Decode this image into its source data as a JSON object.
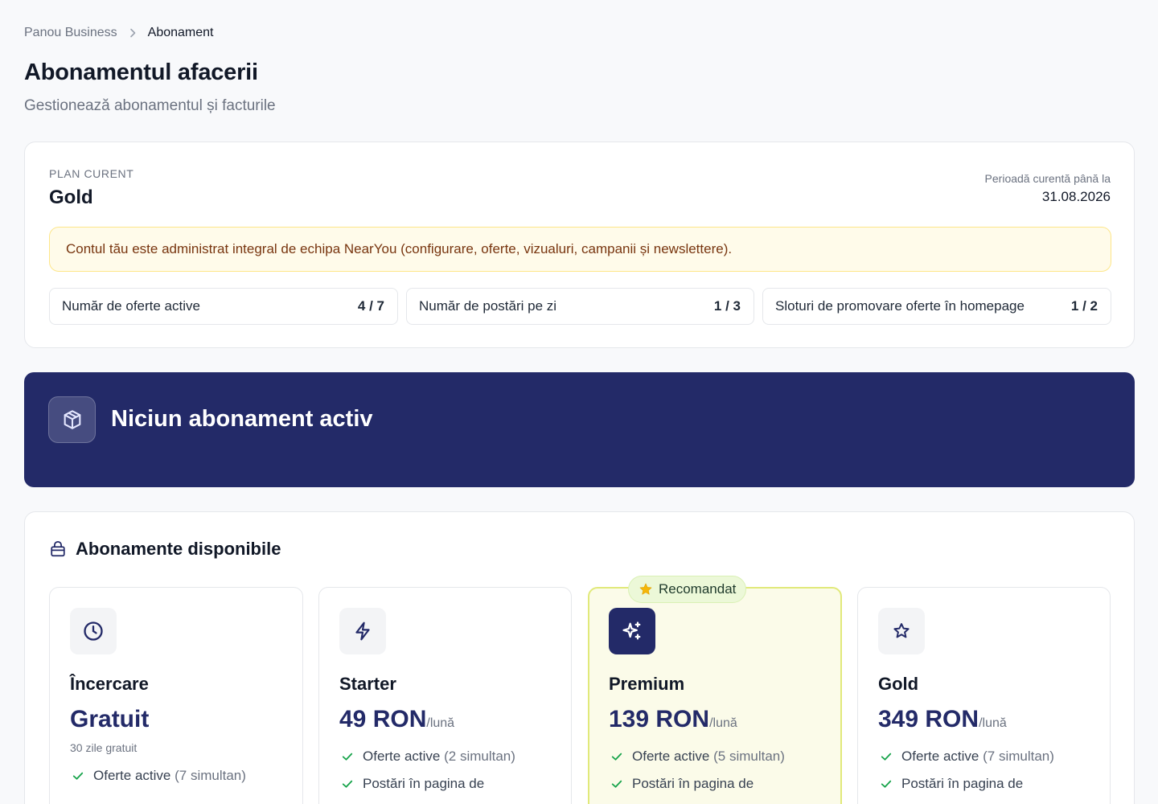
{
  "breadcrumb": {
    "parent": "Panou Business",
    "current": "Abonament"
  },
  "header": {
    "title": "Abonamentul afacerii",
    "subtitle": "Gestionează abonamentul și facturile"
  },
  "current_plan": {
    "label": "PLAN CURENT",
    "name": "Gold",
    "period_label": "Perioadă curentă până la",
    "period_end": "31.08.2026",
    "notice": "Contul tău este administrat integral de echipa NearYou (configurare, oferte, vizualuri, campanii și newslettere).",
    "metrics": [
      {
        "label": "Număr de oferte active",
        "value": "4 / 7"
      },
      {
        "label": "Număr de postări pe zi",
        "value": "1 / 3"
      },
      {
        "label": "Sloturi de promovare oferte în homepage",
        "value": "1 / 2"
      }
    ]
  },
  "banner": {
    "icon": "cube-icon",
    "title": "Niciun abonament activ"
  },
  "available": {
    "title": "Abonamente disponibile",
    "icon": "bag-icon",
    "recommended_label": "Recomandat",
    "plans": [
      {
        "icon": "clock-icon",
        "name": "Încercare",
        "price": "Gratuit",
        "period": "",
        "note": "30 zile gratuit",
        "features": [
          {
            "text": "Oferte active",
            "sub": "(7 simultan)"
          }
        ]
      },
      {
        "icon": "lightning-icon",
        "name": "Starter",
        "price": "49 RON",
        "period": "/lună",
        "note": "",
        "features": [
          {
            "text": "Oferte active",
            "sub": "(2 simultan)"
          },
          {
            "text": "Postări în pagina de",
            "sub": ""
          }
        ]
      },
      {
        "icon": "sparkles-icon",
        "name": "Premium",
        "price": "139 RON",
        "period": "/lună",
        "note": "",
        "features": [
          {
            "text": "Oferte active",
            "sub": "(5 simultan)"
          },
          {
            "text": "Postări în pagina de",
            "sub": ""
          }
        ]
      },
      {
        "icon": "star-icon",
        "name": "Gold",
        "price": "349 RON",
        "period": "/lună",
        "note": "",
        "features": [
          {
            "text": "Oferte active",
            "sub": "(7 simultan)"
          },
          {
            "text": "Postări în pagina de",
            "sub": ""
          }
        ]
      }
    ]
  },
  "colors": {
    "navy": "#232a68",
    "check_green": "#16a34a",
    "notice_bg": "#fffbea",
    "recommended_border": "#e1e97a"
  }
}
